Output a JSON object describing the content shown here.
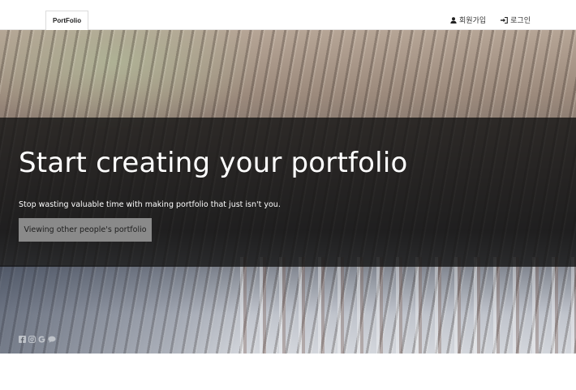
{
  "navbar": {
    "brand": "PortFolio",
    "signup_label": "회원가입",
    "login_label": "로그인",
    "signup_icon": "user-icon",
    "login_icon": "sign-in-icon"
  },
  "hero": {
    "title": "Start creating your portfolio",
    "subtitle": "Stop wasting valuable time with making portfolio that just isn't you.",
    "button_label": "Viewing other people's portfolio"
  },
  "social_icons": [
    "facebook-icon",
    "instagram-icon",
    "google-icon",
    "chat-icon"
  ],
  "colors": {
    "overlay": "#141414",
    "button_bg": "#8a8a8a",
    "icon_gray": "#bfc3c9"
  }
}
